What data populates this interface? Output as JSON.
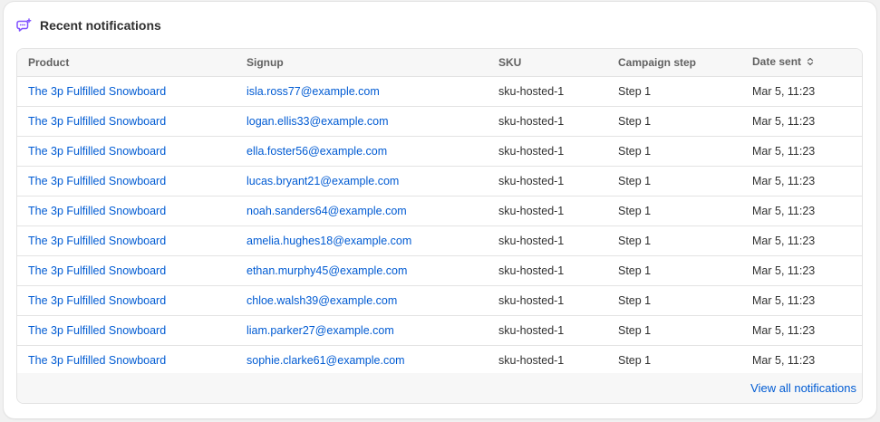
{
  "card": {
    "title": "Recent notifications",
    "icon": "chat-notification-icon",
    "icon_color": "#8051ff"
  },
  "table": {
    "headers": [
      "Product",
      "Signup",
      "SKU",
      "Campaign step",
      "Date sent"
    ],
    "sort_icon": "sort-icon",
    "rows": [
      {
        "product": "The 3p Fulfilled Snowboard",
        "signup": "isla.ross77@example.com",
        "sku": "sku-hosted-1",
        "step": "Step 1",
        "date": "Mar 5, 11:23"
      },
      {
        "product": "The 3p Fulfilled Snowboard",
        "signup": "logan.ellis33@example.com",
        "sku": "sku-hosted-1",
        "step": "Step 1",
        "date": "Mar 5, 11:23"
      },
      {
        "product": "The 3p Fulfilled Snowboard",
        "signup": "ella.foster56@example.com",
        "sku": "sku-hosted-1",
        "step": "Step 1",
        "date": "Mar 5, 11:23"
      },
      {
        "product": "The 3p Fulfilled Snowboard",
        "signup": "lucas.bryant21@example.com",
        "sku": "sku-hosted-1",
        "step": "Step 1",
        "date": "Mar 5, 11:23"
      },
      {
        "product": "The 3p Fulfilled Snowboard",
        "signup": "noah.sanders64@example.com",
        "sku": "sku-hosted-1",
        "step": "Step 1",
        "date": "Mar 5, 11:23"
      },
      {
        "product": "The 3p Fulfilled Snowboard",
        "signup": "amelia.hughes18@example.com",
        "sku": "sku-hosted-1",
        "step": "Step 1",
        "date": "Mar 5, 11:23"
      },
      {
        "product": "The 3p Fulfilled Snowboard",
        "signup": "ethan.murphy45@example.com",
        "sku": "sku-hosted-1",
        "step": "Step 1",
        "date": "Mar 5, 11:23"
      },
      {
        "product": "The 3p Fulfilled Snowboard",
        "signup": "chloe.walsh39@example.com",
        "sku": "sku-hosted-1",
        "step": "Step 1",
        "date": "Mar 5, 11:23"
      },
      {
        "product": "The 3p Fulfilled Snowboard",
        "signup": "liam.parker27@example.com",
        "sku": "sku-hosted-1",
        "step": "Step 1",
        "date": "Mar 5, 11:23"
      },
      {
        "product": "The 3p Fulfilled Snowboard",
        "signup": "sophie.clarke61@example.com",
        "sku": "sku-hosted-1",
        "step": "Step 1",
        "date": "Mar 5, 11:23"
      }
    ]
  },
  "footer": {
    "link_label": "View all notifications"
  },
  "colors": {
    "link": "#005bd3",
    "text": "#303030",
    "header_text": "#616161"
  }
}
